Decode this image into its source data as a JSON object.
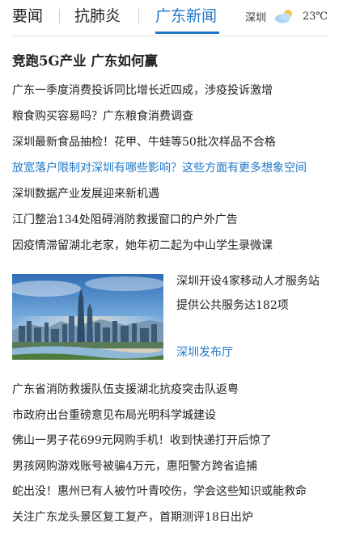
{
  "tabs": [
    {
      "label": "要闻",
      "active": false
    },
    {
      "label": "抗肺炎",
      "active": false
    },
    {
      "label": "广东新闻",
      "active": true
    }
  ],
  "weather": {
    "city": "深圳",
    "icon": "partly-sunny-icon",
    "temperature": "23℃"
  },
  "headline": "竞跑5G产业 广东如何赢",
  "news_top": [
    "广东一季度消费投诉同比增长近四成，涉疫投诉激增",
    "粮食购买容易吗？广东粮食消费调查",
    "深圳最新食品抽检！花甲、牛蛙等50批次样品不合格",
    "放宽落户限制对深圳有哪些影响？这些方面有更多想象空间",
    "深圳数据产业发展迎来新机遇",
    "江门整治134处阻碍消防救援窗口的户外广告",
    "因疫情滞留湖北老家，她年初二起为中山学生录微课"
  ],
  "feature": {
    "line1": "深圳开设4家移动人才服务站",
    "line2": "提供公共服务达182项",
    "source": "深圳发布厅",
    "image": "shenzhen-skyline-photo"
  },
  "news_bottom": [
    "广东省消防救援队伍支援湖北抗疫突击队返粤",
    "市政府出台重磅意见布局光明科学城建设",
    "佛山一男子花699元网购手机！收到快递打开后惊了",
    "男孩网购游戏账号被骗4万元，惠阳警方跨省追捕",
    "蛇出没！惠州已有人被竹叶青咬伤，学会这些知识或能救命",
    "关注广东龙头景区复工复产，首期测评18日出炉"
  ],
  "colors": {
    "accent": "#1e78c8",
    "text": "#222222",
    "divider": "#e3e3e3"
  }
}
